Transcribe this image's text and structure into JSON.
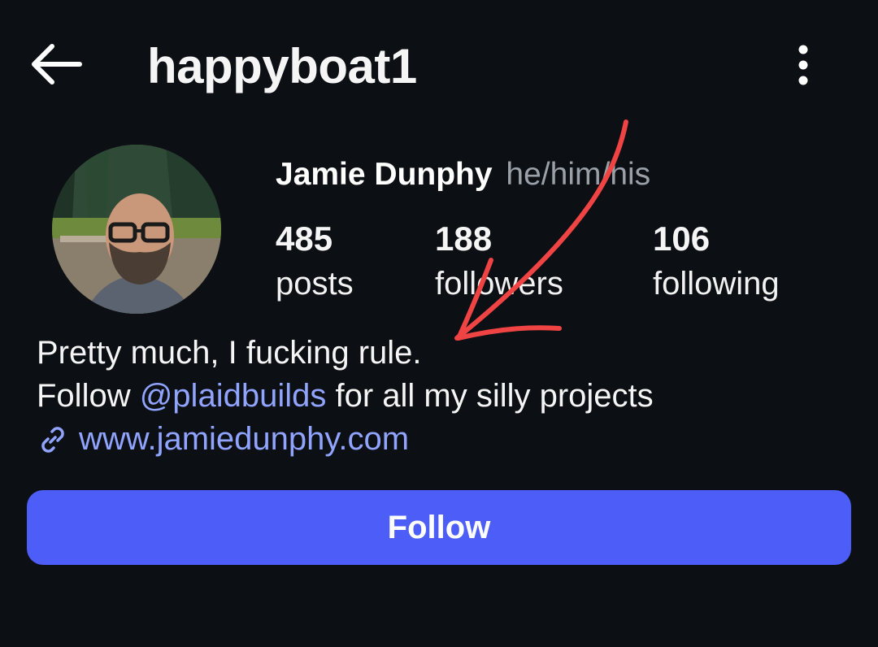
{
  "header": {
    "username": "happyboat1",
    "back_icon": "back-arrow-icon",
    "more_icon": "more-vertical-icon"
  },
  "profile": {
    "display_name": "Jamie Dunphy",
    "pronouns": "he/him/his",
    "stats": [
      {
        "count": "485",
        "label": "posts"
      },
      {
        "count": "188",
        "label": "followers"
      },
      {
        "count": "106",
        "label": "following"
      }
    ]
  },
  "bio": {
    "line1": "Pretty much, I fucking rule.",
    "line2_prefix": "Follow ",
    "mention": "@plaidbuilds",
    "line2_suffix": " for all my silly projects",
    "link_icon": "link-icon",
    "link": "www.jamiedunphy.com"
  },
  "actions": {
    "follow_label": "Follow"
  },
  "colors": {
    "background": "#0c0f14",
    "accent": "#4c5ef7",
    "link": "#8fa3ff",
    "muted": "#9aa0a8",
    "annotation": "#f04444"
  }
}
